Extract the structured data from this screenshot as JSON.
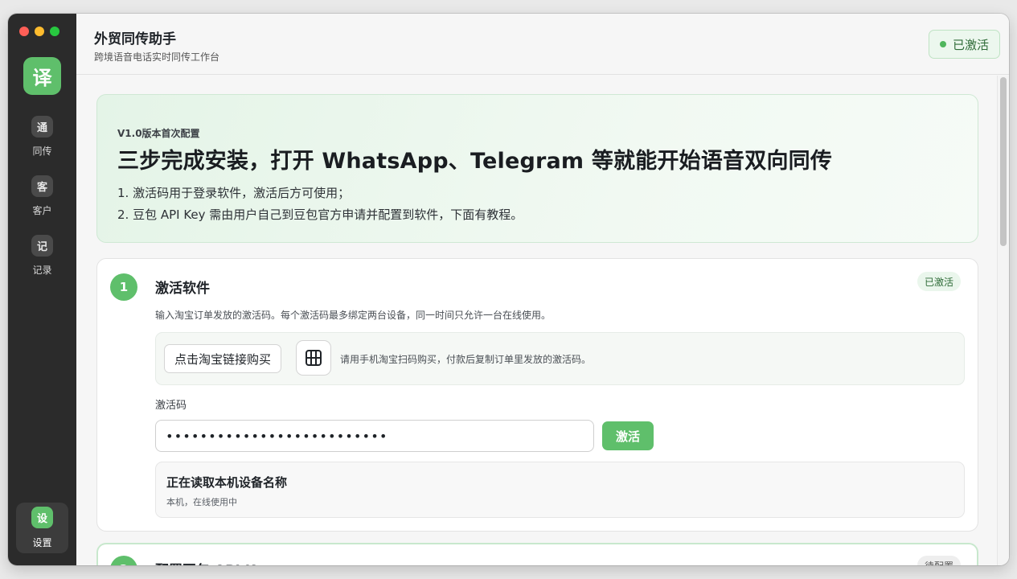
{
  "sidebar": {
    "logo_glyph": "译",
    "items": [
      {
        "icon_glyph": "通",
        "label": "同传"
      },
      {
        "icon_glyph": "客",
        "label": "客户"
      },
      {
        "icon_glyph": "记",
        "label": "记录"
      },
      {
        "icon_glyph": "设",
        "label": "设置"
      }
    ],
    "active_index": 3
  },
  "header": {
    "title": "外贸同传助手",
    "subtitle": "跨境语音电话实时同传工作台",
    "status": "已激活"
  },
  "hero": {
    "eyebrow": "V1.0版本首次配置",
    "title": "三步完成安装，打开 WhatsApp、Telegram 等就能开始语音双向同传",
    "lines": [
      "1. 激活码用于登录软件，激活后方可使用；",
      "2. 豆包 API Key 需由用户自己到豆包官方申请并配置到软件，下面有教程。"
    ]
  },
  "step1": {
    "number": "1",
    "title": "激活软件",
    "badge": "已激活",
    "desc": "输入淘宝订单发放的激活码。每个激活码最多绑定两台设备，同一时间只允许一台在线使用。",
    "buy_label": "点击淘宝链接购买",
    "qr_icon": "qr-grid-icon",
    "buy_hint": "请用手机淘宝扫码购买，付款后复制订单里发放的激活码。",
    "field_label": "激活码",
    "code_value": "••••••••••••••••••••••••••",
    "activate_label": "激活",
    "device_title": "正在读取本机设备名称",
    "device_sub": "本机，在线使用中"
  },
  "step2": {
    "number": "2",
    "title": "配置豆包 API K",
    "badge": "待配置"
  },
  "colors": {
    "accent": "#5fbf6b",
    "sidebar_bg": "#2b2b2b",
    "badge_bg": "#eaf6ec"
  }
}
